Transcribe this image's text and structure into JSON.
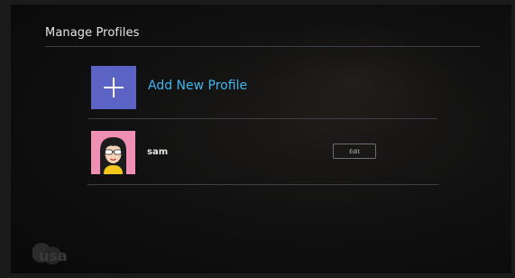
{
  "page": {
    "title": "Manage Profiles"
  },
  "add_profile": {
    "label": "Add New Profile",
    "icon": "plus-icon",
    "tile_color": "#5b63c4",
    "label_color": "#3fb6ee"
  },
  "profiles": [
    {
      "name": "sam",
      "avatar_icon": "avatar-icon",
      "avatar_color": "#f08fb4",
      "edit_label": "Edit"
    }
  ],
  "brand": {
    "logo_text": "usa",
    "icon": "usa-logo-icon"
  }
}
